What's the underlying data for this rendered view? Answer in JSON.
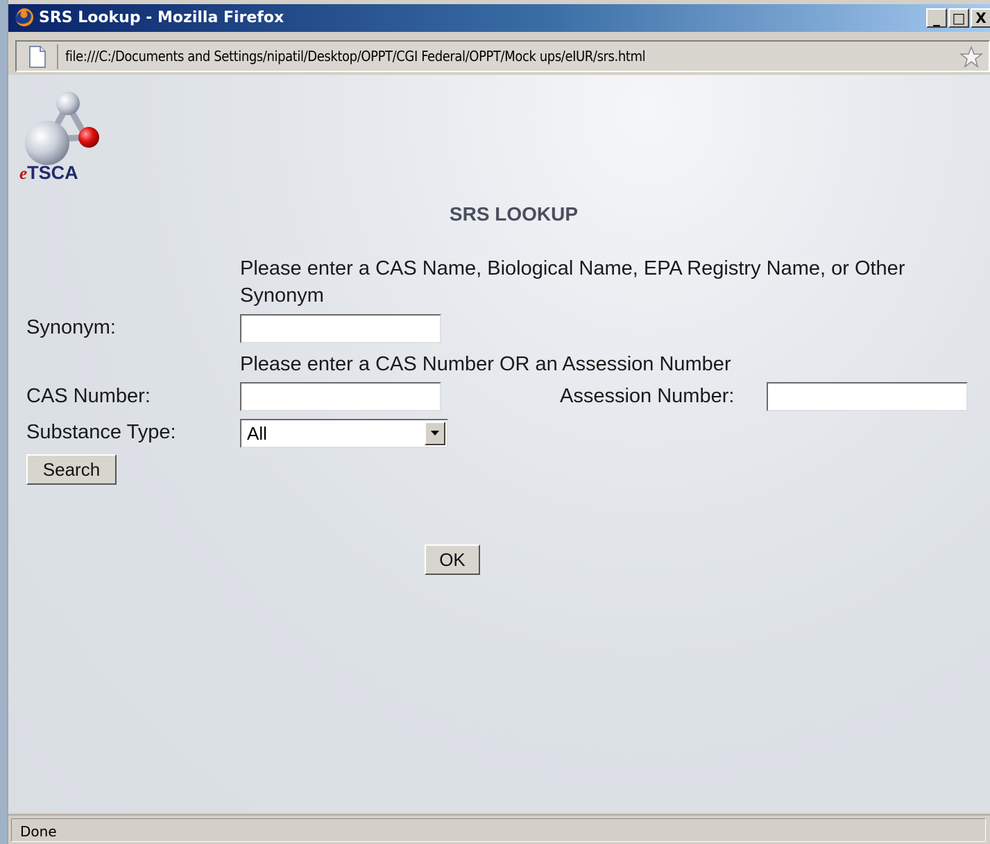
{
  "window": {
    "title": "SRS Lookup - Mozilla Firefox",
    "controls": {
      "minimize": "_",
      "maximize": "□",
      "close": "X"
    }
  },
  "address_bar": {
    "url": "file:///C:/Documents and Settings/nipatil/Desktop/OPPT/CGI Federal/OPPT/Mock ups/eIUR/srs.html"
  },
  "logo": {
    "text": "eTSCA",
    "prefix": "e",
    "suffix": "TSCA"
  },
  "form": {
    "heading": "SRS LOOKUP",
    "synonym_instruction": "Please enter a CAS Name, Biological Name, EPA Registry Name, or Other Synonym",
    "synonym_label": "Synonym:",
    "synonym_value": "",
    "number_instruction": "Please enter a CAS Number OR an Assession Number",
    "cas_label": "CAS Number:",
    "cas_value": "",
    "assession_label": "Assession Number:",
    "assession_value": "",
    "substance_label": "Substance Type:",
    "substance_selected": "All",
    "search_button": "Search",
    "ok_button": "OK"
  },
  "status_bar": {
    "text": "Done"
  },
  "colors": {
    "titlebar_start": "#0a246a",
    "titlebar_end": "#a6caf0",
    "logo_red": "#e01010",
    "logo_navy": "#1f2a6b"
  }
}
